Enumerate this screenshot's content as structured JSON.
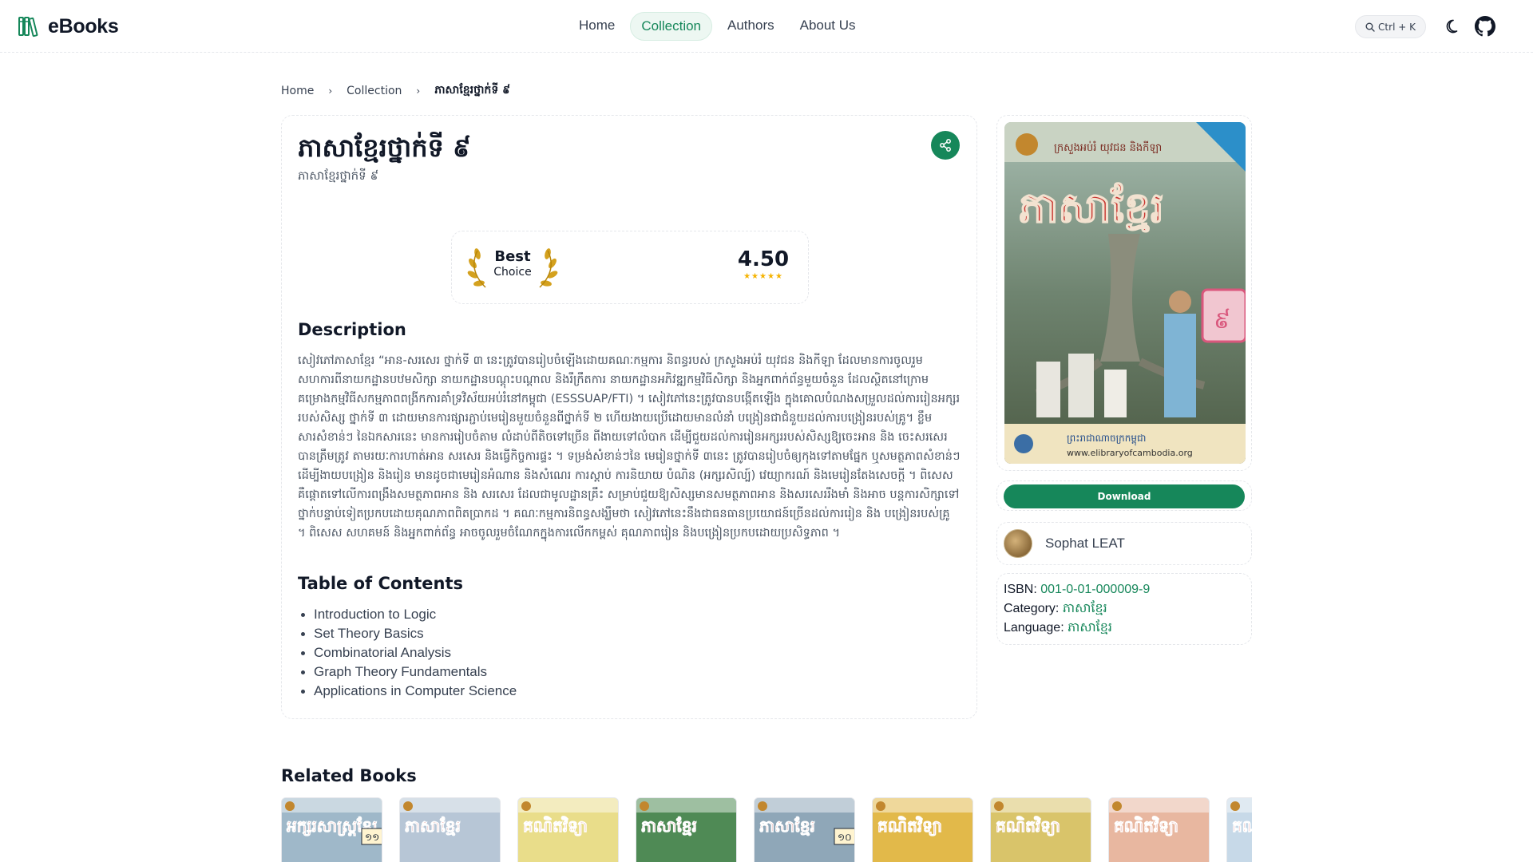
{
  "brand": {
    "name": "eBooks",
    "accent": "#16875a"
  },
  "nav": {
    "items": [
      {
        "label": "Home",
        "active": false
      },
      {
        "label": "Collection",
        "active": true
      },
      {
        "label": "Authors",
        "active": false
      },
      {
        "label": "About Us",
        "active": false
      }
    ],
    "search_shortcut": "Ctrl + K",
    "theme_icon": "moon-icon",
    "repo_icon": "github-icon"
  },
  "breadcrumb": {
    "home": "Home",
    "collection": "Collection",
    "current": "ភាសាខ្មែរថ្នាក់ទី ៩"
  },
  "book": {
    "title": "ភាសាខ្មែរថ្នាក់ទី ៩",
    "subtitle": "ភាសាខ្មែរថ្នាក់ទី ៩",
    "badge_line1": "Best",
    "badge_line2": "Choice",
    "rating": "4.50",
    "stars": "★★★★★",
    "description_heading": "Description",
    "description": "សៀវភៅភាសាខ្មែរ “អាន-សរសេរ ថ្នាក់ទី ៣ នេះត្រូវបានរៀបចំឡើងដោយគណៈកម្មការ និពន្ធរបស់ ក្រសួងអប់រំ យុវជន និងកីឡា ដែលមានការចូលរួមសហការពីនាយកដ្ឋានបឋមសិក្សា នាយកដ្ឋានបណ្ដុះបណ្ដាល និងរឹក្រឹតការ នាយកដ្ឋានអភិវឌ្ឍកម្មវិធីសិក្សា និងអ្នកពាក់ព័ន្ធមួយចំនួន ដែលស្ថិតនៅក្រោមគម្រោងកម្មវិធីសកម្មភាពពង្រីកការគាំទ្រវិស័យអប់រំនៅកម្ពុជា (ESSSUAP/FTI) ។ សៀវភៅនេះត្រូវបានបង្កើតឡើង ក្នុងគោលបំណងសម្រួលដល់ការរៀនអក្សរ របស់សិស្ស ថ្នាក់ទី ៣ ដោយមានការផ្សារភ្ជាប់មេរៀនមួយចំនួនពីថ្នាក់ទី ២ ហើយងាយប្រើដោយមានលំនាំ បង្រៀនជាជំនួយដល់ការបង្រៀនរបស់គ្រូ។ ខ្លឹមសារសំខាន់ៗ នៃឯកសារនេះ មានការរៀបចំតាម លំដាប់ពីតិចទៅច្រើន ពីងាយទៅលំបាក ដើម្បីជួយដល់ការរៀនអក្សររបស់សិស្សឱ្យចេះអាន និង ចេះសរសេរបានត្រឹមត្រូវ តាមរយៈការហាត់អាន សរសេរ និងធ្វើកិច្ចការផ្ទះ ។ ទម្រង់សំខាន់ៗនៃ មេរៀនថ្នាក់ទី ៣នេះ ត្រូវបានរៀបចំឲ្យកុងទៅតាមផ្នែក ឬសមត្ថភាពសំខាន់ៗ ដើម្បីងាយបង្រៀន និងរៀន មានដូចជាមេរៀនអំណាន និងសំណេរ ការស្ដាប់ ការនិយាយ បំណិន (អក្សរសិល្ប៍) វេយ្យាករណ៍ និងមេរៀនតែងសេចក្ដី ។ ពិសេស គឺផ្ដោតទៅលើការពង្រឹងសមត្ថភាពអាន និង សរសេរ ដែលជាមូលដ្ឋានគ្រឹះ សម្រាប់ជួយឱ្យសិស្សមានសមត្ថភាពអាន និងសរសេររឹងមាំ និងអាច បន្តការសិក្សាទៅថ្នាក់បន្ទាប់ទៀតប្រកបដោយគុណភាពពិតប្រាកដ ។ គណៈកម្មការនិពន្ធសង្ឃឹមថា សៀវភៅនេះនឹងជាធនធានប្រយោជន៍ច្រើនដល់ការរៀន និង បង្រៀនរបស់គ្រូ ។ ពិសេស សហគមន៍ និងអ្នកពាក់ព័ន្ធ អាចចូលរួមចំណែកក្នុងការលើកកម្ពស់ គុណភាពរៀន និងបង្រៀនប្រកបដោយប្រសិទ្ធភាព ។",
    "toc_heading": "Table of Contents",
    "toc": [
      "Introduction to Logic",
      "Set Theory Basics",
      "Combinatorial Analysis",
      "Graph Theory Fundamentals",
      "Applications in Computer Science"
    ],
    "cover_title": "ភាសាខ្មែរ",
    "cover_grade": "៩",
    "cover_header": "ក្រសួងអប់រំ យុវជន និងកីឡា",
    "cover_footer": "ព្រះរាជាណាចក្រកម្ពុជា",
    "cover_url": "www.elibraryofcambodia.org"
  },
  "sidebar": {
    "download_label": "Download",
    "author_name": "Sophat LEAT",
    "isbn_label": "ISBN:",
    "isbn": "001-0-01-000009-9",
    "category_label": "Category:",
    "category": "ភាសាខ្មែរ",
    "language_label": "Language:",
    "language": "ភាសាខ្មែរ"
  },
  "related": {
    "heading": "Related Books",
    "books": [
      {
        "title": "អក្សរសាស្ត្រខ្មែរ",
        "grade": "១១",
        "color": "#9fb8c9"
      },
      {
        "title": "ភាសាខ្មែរ",
        "grade": "",
        "color": "#b7c6d6"
      },
      {
        "title": "គណិតវិទ្យា",
        "grade": "",
        "color": "#e9dd8a"
      },
      {
        "title": "ភាសាខ្មែរ",
        "grade": "",
        "color": "#4f8a55"
      },
      {
        "title": "ភាសាខ្មែរ",
        "grade": "១០",
        "color": "#8fa7b8"
      },
      {
        "title": "គណិតវិទ្យា",
        "grade": "",
        "color": "#e2b94a"
      },
      {
        "title": "គណិតវិទ្យា",
        "grade": "",
        "color": "#d9c46a"
      },
      {
        "title": "គណិតវិទ្យា",
        "grade": "",
        "color": "#e8b7a0"
      },
      {
        "title": "គណិ",
        "grade": "",
        "color": "#c7d9e8"
      }
    ]
  }
}
